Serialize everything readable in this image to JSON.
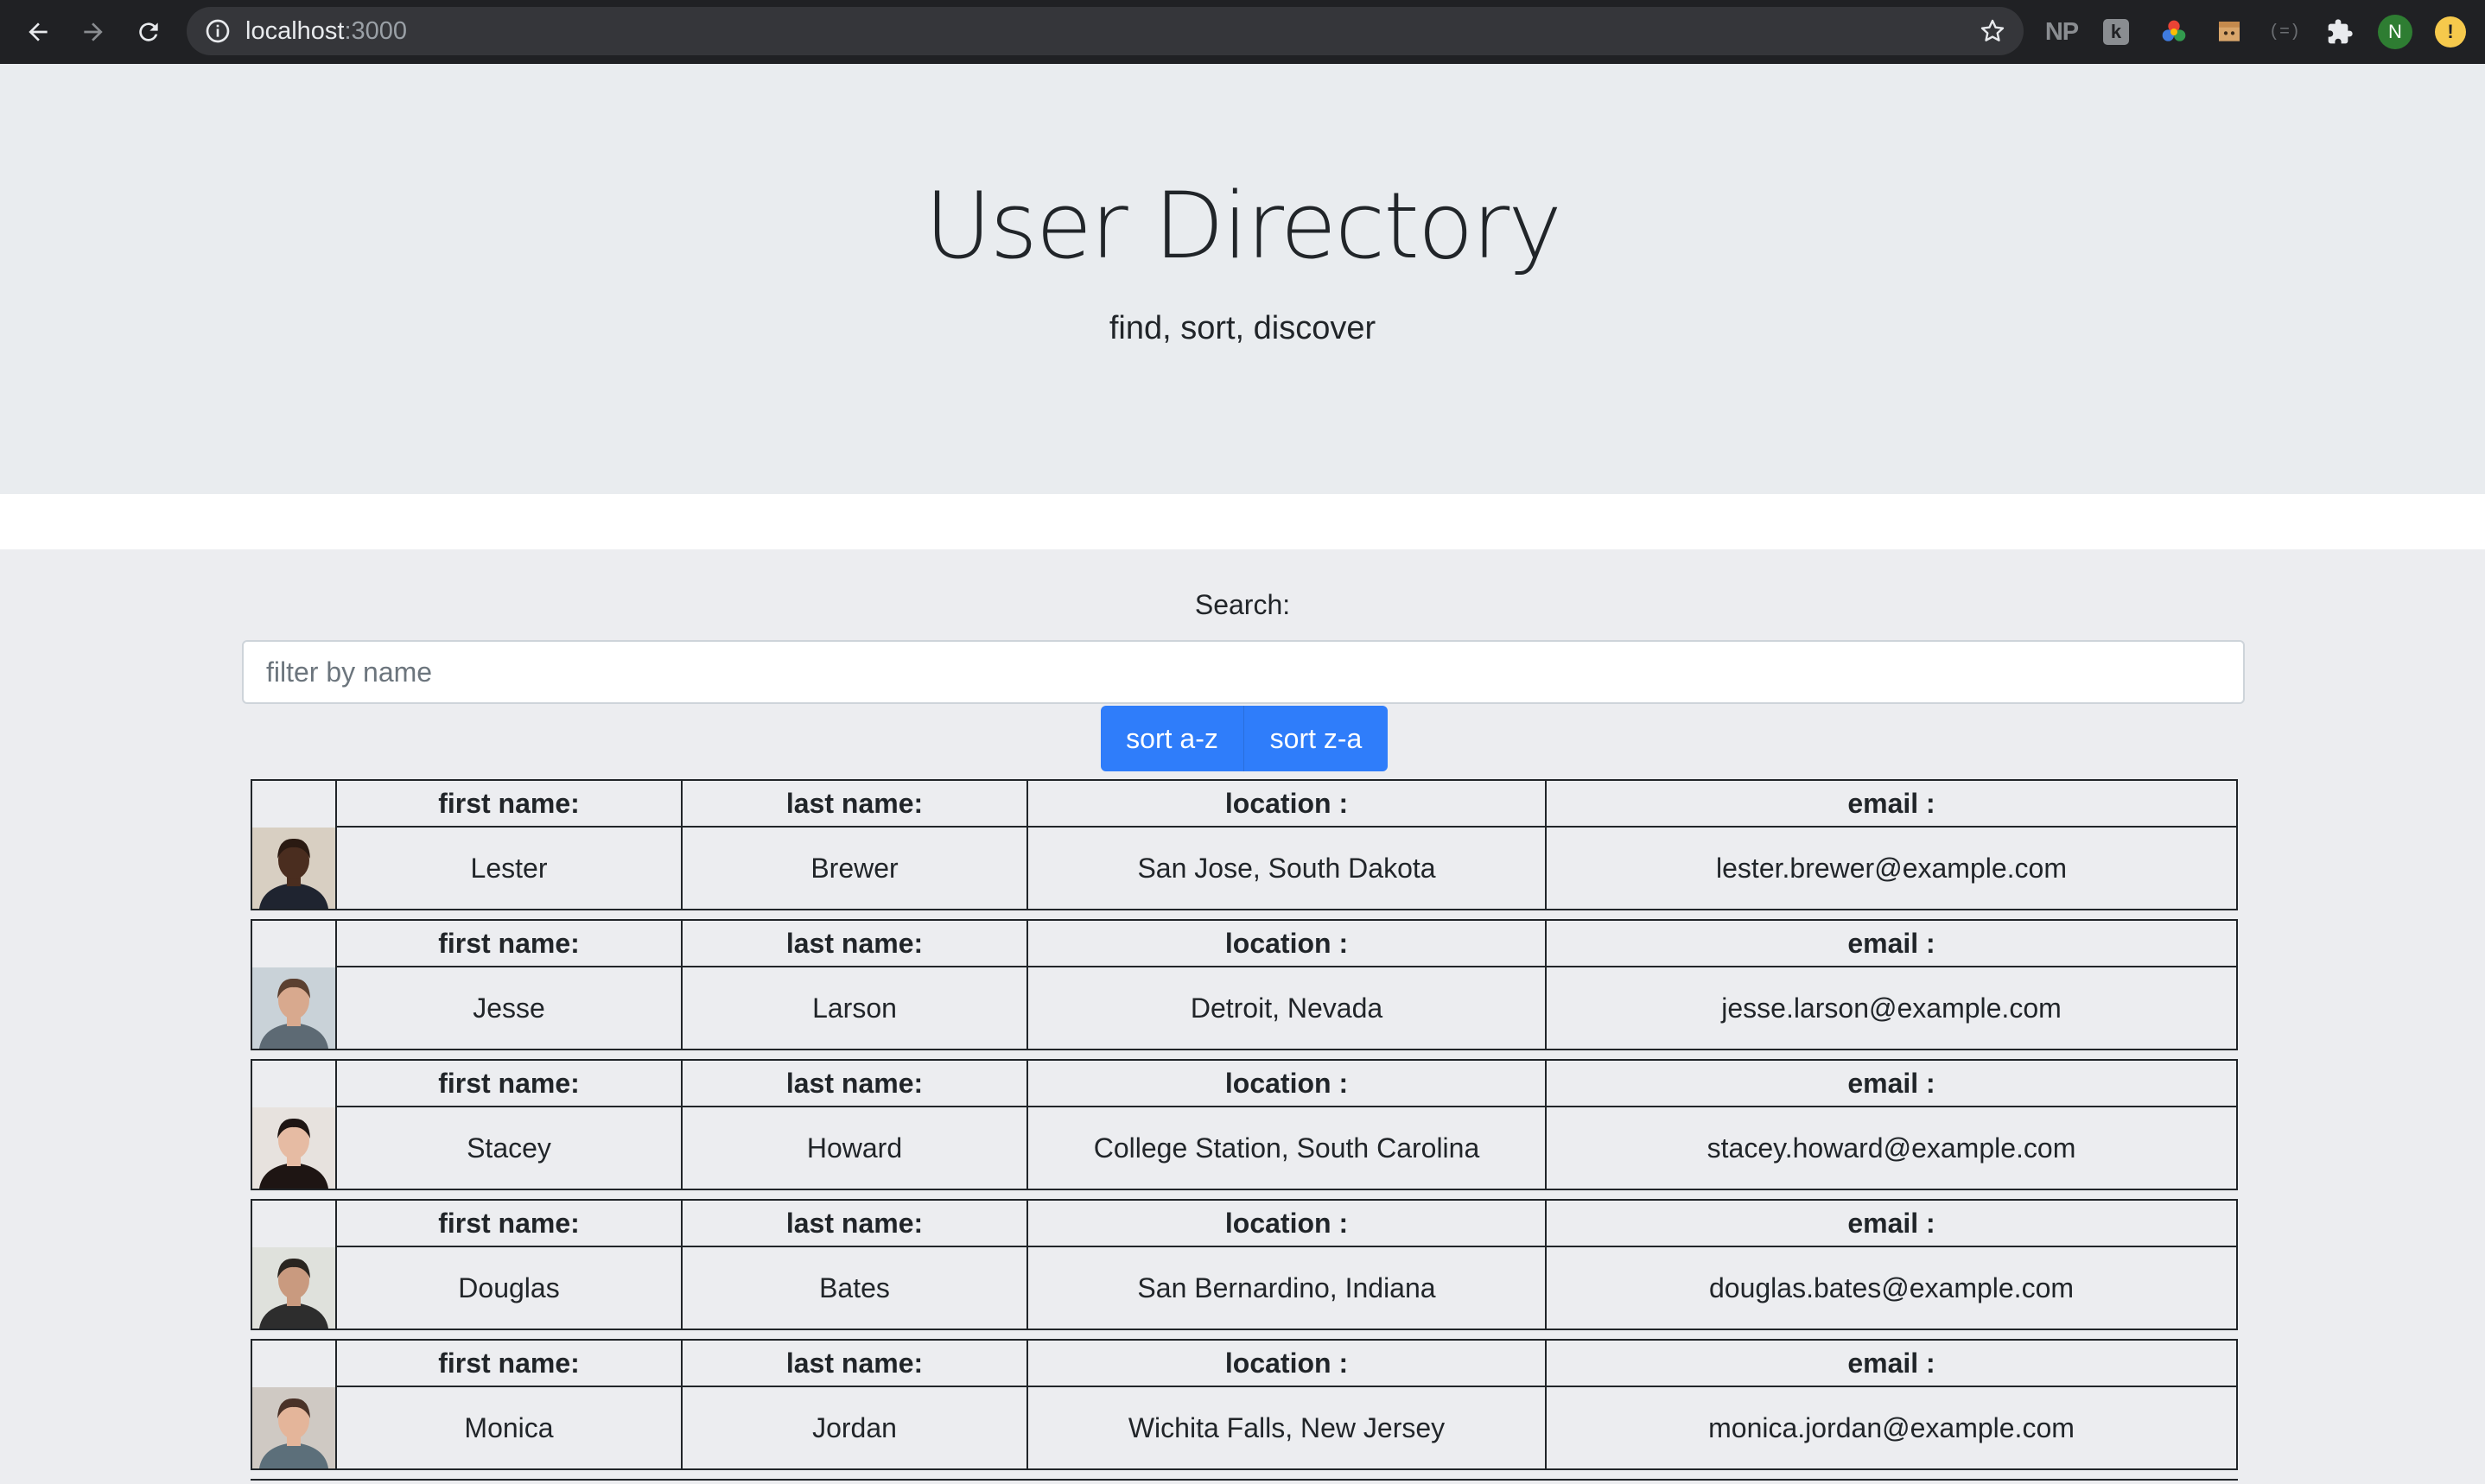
{
  "browser": {
    "url_host": "localhost",
    "url_port": ":3000",
    "extensions": {
      "np": "NP",
      "k": "k",
      "brackets": "(=)"
    },
    "profile_initial": "N",
    "alert_symbol": "!"
  },
  "hero": {
    "title": "User Directory",
    "subtitle": "find, sort, discover"
  },
  "search": {
    "label": "Search:",
    "placeholder": "filter by name",
    "sort_asc_label": "sort a-z",
    "sort_desc_label": "sort z-a"
  },
  "columns": {
    "first": "first name:",
    "last": "last name:",
    "location": "location :",
    "email": "email :"
  },
  "users": [
    {
      "first": "Lester",
      "last": "Brewer",
      "location": "San Jose, South Dakota",
      "email": "lester.brewer@example.com",
      "photo": {
        "bg": "#d8cfc2",
        "skin": "#4a2d1f",
        "hair": "#2a1a12",
        "shirt": "#1f2430"
      }
    },
    {
      "first": "Jesse",
      "last": "Larson",
      "location": "Detroit, Nevada",
      "email": "jesse.larson@example.com",
      "photo": {
        "bg": "#c9d2d8",
        "skin": "#d8a98e",
        "hair": "#5b4030",
        "shirt": "#5d6a74"
      }
    },
    {
      "first": "Stacey",
      "last": "Howard",
      "location": "College Station, South Carolina",
      "email": "stacey.howard@example.com",
      "photo": {
        "bg": "#e7e2de",
        "skin": "#e6bba3",
        "hair": "#1e1513",
        "shirt": "#1e1513"
      }
    },
    {
      "first": "Douglas",
      "last": "Bates",
      "location": "San Bernardino, Indiana",
      "email": "douglas.bates@example.com",
      "photo": {
        "bg": "#dfe1dc",
        "skin": "#c99a7f",
        "hair": "#2a2520",
        "shirt": "#2d2d2d"
      }
    },
    {
      "first": "Monica",
      "last": "Jordan",
      "location": "Wichita Falls, New Jersey",
      "email": "monica.jordan@example.com",
      "photo": {
        "bg": "#cfc9c3",
        "skin": "#e4b59a",
        "hair": "#4a3228",
        "shirt": "#5c6f7a"
      }
    }
  ]
}
